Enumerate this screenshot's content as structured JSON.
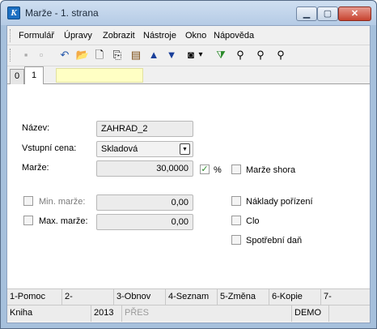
{
  "window": {
    "title": "Marže - 1. strana",
    "icon": "app-icon",
    "controls": {
      "minimize": "▁",
      "maximize": "▢",
      "close": "✕"
    }
  },
  "menu": {
    "items": [
      "Formulář",
      "Úpravy",
      "Zobrazit",
      "Nástroje",
      "Okno",
      "Nápověda"
    ]
  },
  "toolbar": {
    "buttons": [
      {
        "icon": "save-icon",
        "glyph": "▪"
      },
      {
        "icon": "save-as-icon",
        "glyph": "▫"
      },
      {
        "icon": "undo-icon",
        "glyph": "↶"
      },
      {
        "icon": "open-folder-icon",
        "glyph": "📂"
      },
      {
        "icon": "new-document-icon",
        "glyph": "🗋"
      },
      {
        "icon": "copy-icon",
        "glyph": "⎘"
      },
      {
        "icon": "book-icon",
        "glyph": "▤"
      },
      {
        "icon": "arrow-up-icon",
        "glyph": "▲"
      },
      {
        "icon": "arrow-down-icon",
        "glyph": "▼"
      },
      {
        "icon": "camera-icon",
        "glyph": "◙"
      },
      {
        "icon": "dropdown-arrow-icon",
        "glyph": "▾"
      },
      {
        "icon": "filter-icon",
        "glyph": "⧩"
      },
      {
        "icon": "binoculars-icon",
        "glyph": "⚲"
      },
      {
        "icon": "binoculars-next-icon",
        "glyph": "⚲"
      },
      {
        "icon": "binoculars-prev-icon",
        "glyph": "⚲"
      }
    ]
  },
  "tabs": [
    {
      "label": "0"
    },
    {
      "label": "1"
    }
  ],
  "form": {
    "nazev_label": "Název:",
    "nazev_value": "ZAHRAD_2",
    "vstupni_cena_label": "Vstupní cena:",
    "vstupni_cena_value": "Skladová",
    "marze_label": "Marže:",
    "marze_value": "30,0000",
    "percent_label": "%",
    "marze_shora_label": "Marže shora",
    "min_marze_label": "Min. marže:",
    "min_marze_value": "0,00",
    "max_marze_label": "Max. marže:",
    "max_marze_value": "0,00",
    "naklady_label": "Náklady pořízení",
    "clo_label": "Clo",
    "spotrebni_dan_label": "Spotřební daň"
  },
  "function_keys": [
    "1-Pomoc",
    "2-",
    "3-Obnov",
    "4-Seznam",
    "5-Změna",
    "6-Kopie",
    "7-"
  ],
  "status": {
    "module": "Kniha",
    "year": "2013",
    "mode": "PŘES",
    "user": "DEMO"
  },
  "colors": {
    "title_bar": "#b5cbe5",
    "tab_title_bg": "#ffffc4",
    "checkbox_check": "#2a8a2a"
  }
}
